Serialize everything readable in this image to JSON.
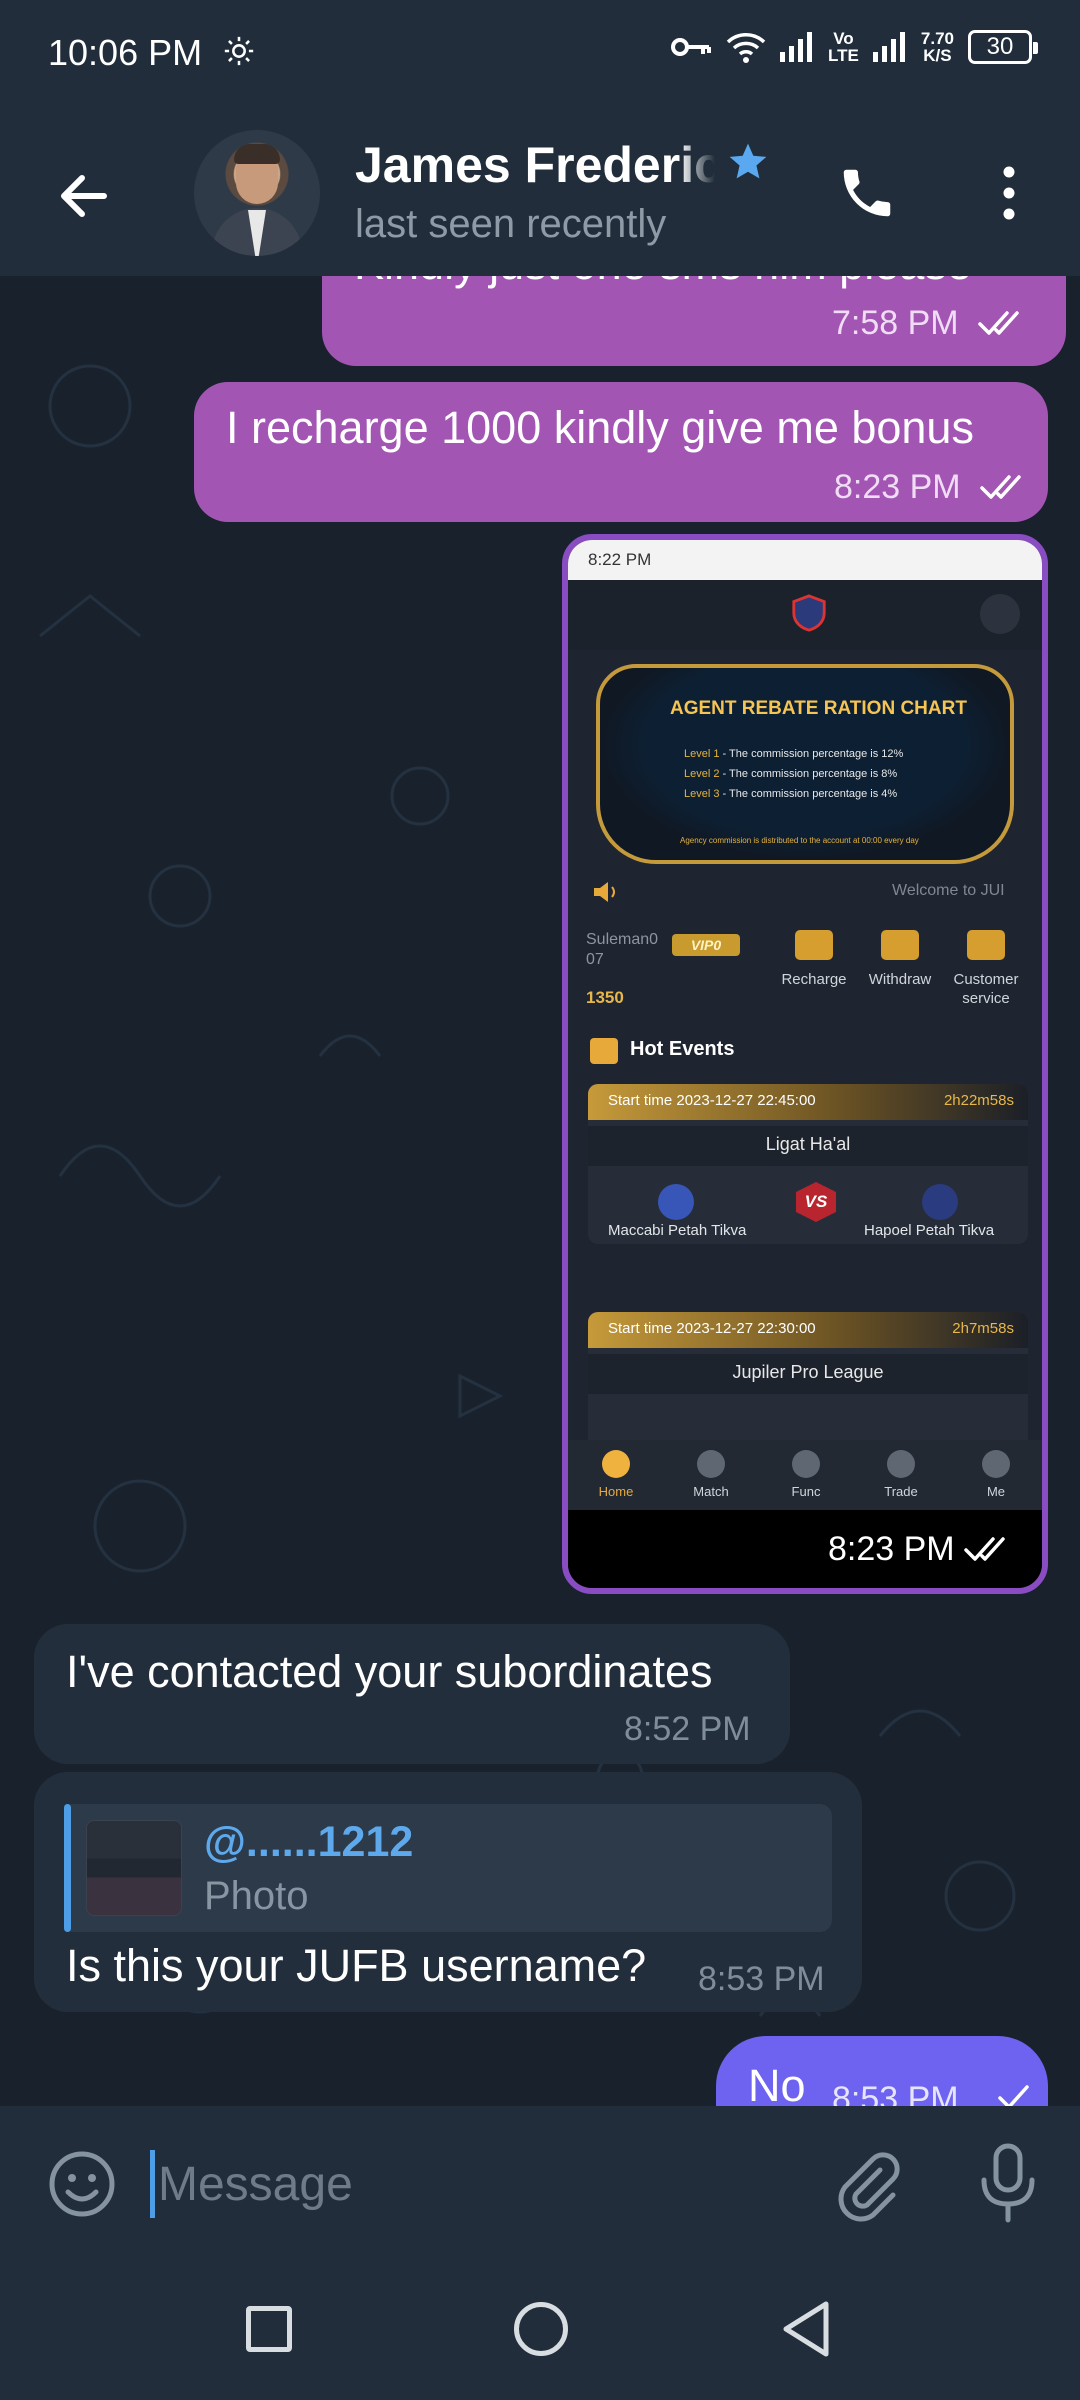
{
  "status_bar": {
    "time": "10:06 PM",
    "network_label": "Vo\nLTE",
    "speed_value": "7.70",
    "speed_unit": "K/S",
    "battery": "30"
  },
  "header": {
    "contact_name": "James Frederic",
    "last_seen": "last seen recently"
  },
  "messages": [
    {
      "id": "m1",
      "direction": "out",
      "text": "Kindly just one sms him please",
      "time": "7:58 PM",
      "status": "read"
    },
    {
      "id": "m2",
      "direction": "out",
      "text": "I recharge 1000 kindly give me bonus",
      "time": "8:23 PM",
      "status": "read"
    },
    {
      "id": "m3",
      "direction": "out",
      "type": "photo",
      "time": "8:23 PM",
      "status": "read"
    },
    {
      "id": "m4",
      "direction": "in",
      "text": "I've contacted your subordinates",
      "time": "8:52 PM"
    },
    {
      "id": "m5",
      "direction": "in",
      "text": "Is this your JUFB username?",
      "time": "8:53 PM",
      "reply_to": {
        "author": "@......1212",
        "kind": "Photo"
      }
    },
    {
      "id": "m6",
      "direction": "out",
      "text": "No",
      "time": "8:53 PM",
      "status": "sent"
    }
  ],
  "screenshot": {
    "status_time": "8:22 PM",
    "banner_title": "AGENT REBATE RATION CHART",
    "levels": [
      {
        "label": "Level 1",
        "text": " - The commission percentage is 12%"
      },
      {
        "label": "Level 2",
        "text": " - The commission percentage is 8%"
      },
      {
        "label": "Level 3",
        "text": " - The commission percentage is 4%"
      }
    ],
    "agency_note": "Agency commission is distributed to the account at 00:00 every day",
    "welcome": "Welcome to JUI",
    "username_line1": "Suleman0",
    "username_line2": "07",
    "vip": "VIP0",
    "balance": "1350",
    "actions": [
      "Recharge",
      "Withdraw",
      "Customer service"
    ],
    "hot_events_title": "Hot Events",
    "events": [
      {
        "start": "Start time 2023-12-27 22:45:00",
        "countdown": "2h22m58s",
        "league": "Ligat Ha'al",
        "home": "Maccabi Petah Tikva",
        "away": "Hapoel Petah Tikva"
      },
      {
        "start": "Start time 2023-12-27 22:30:00",
        "countdown": "2h7m58s",
        "league": "Jupiler Pro League",
        "home": "",
        "away": ""
      }
    ],
    "vs": "VS",
    "nav": [
      "Home",
      "Match",
      "Func",
      "Trade",
      "Me"
    ]
  },
  "input": {
    "placeholder": "Message"
  },
  "colors": {
    "outgoing_bubble": "#a355b4",
    "incoming_bubble": "#222e3b",
    "accent_blue": "#4d9ee6",
    "last_outgoing_bubble": "#6e63f0"
  }
}
